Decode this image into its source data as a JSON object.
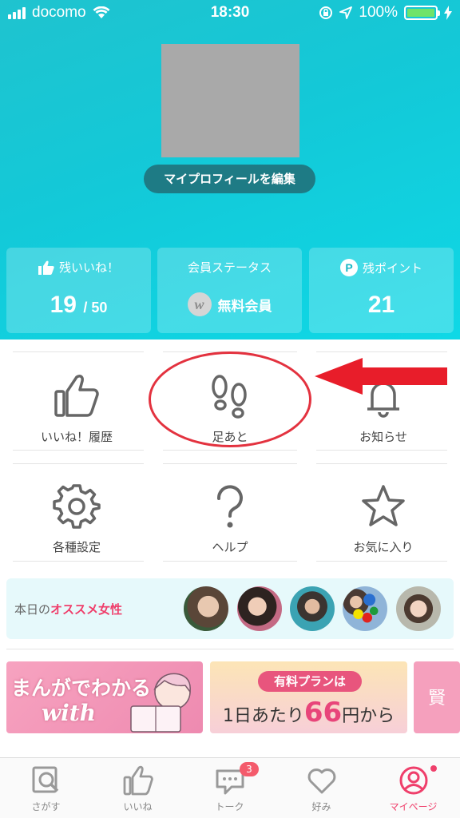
{
  "status_bar": {
    "carrier": "docomo",
    "time": "18:30",
    "battery": "100%"
  },
  "profile": {
    "edit_button": "マイプロフィールを編集"
  },
  "stats": {
    "likes": {
      "label": "残いいね！",
      "value": "19",
      "total": "/ 50"
    },
    "membership": {
      "label": "会員ステータス",
      "value": "無料会員",
      "badge": "w"
    },
    "points": {
      "label": "残ポイント",
      "value": "21",
      "badge": "P"
    }
  },
  "menu": {
    "items": [
      {
        "label": "いいね！履歴",
        "icon": "thumbs-up-icon"
      },
      {
        "label": "足あと",
        "icon": "footprints-icon"
      },
      {
        "label": "お知らせ",
        "icon": "bell-icon"
      },
      {
        "label": "各種設定",
        "icon": "gear-icon"
      },
      {
        "label": "ヘルプ",
        "icon": "question-icon"
      },
      {
        "label": "お気に入り",
        "icon": "star-icon"
      }
    ]
  },
  "recommend": {
    "title_prefix": "本日の",
    "title_highlight": "オススメ女性"
  },
  "banners": {
    "manga_line1": "まんがでわかる",
    "manga_line2": "with",
    "plan_pill": "有料プランは",
    "plan_prefix": "1日あたり",
    "plan_price": "66",
    "plan_suffix": "円から",
    "partial": "賢"
  },
  "tabbar": {
    "items": [
      {
        "label": "さがす",
        "icon": "search-icon"
      },
      {
        "label": "いいね",
        "icon": "thumbs-up-icon"
      },
      {
        "label": "トーク",
        "icon": "chat-icon"
      },
      {
        "label": "好み",
        "icon": "heart-icon"
      },
      {
        "label": "マイページ",
        "icon": "user-icon"
      }
    ],
    "talk_badge": "3",
    "active": "マイページ"
  },
  "colors": {
    "header": "#13c9d8",
    "accent_pink": "#ef3f6b",
    "annotation_red": "#e3323f"
  }
}
